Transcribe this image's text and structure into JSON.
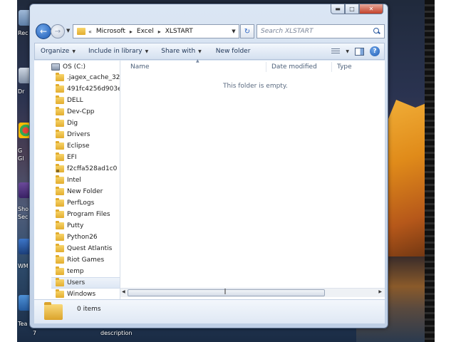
{
  "desktop": {
    "icon_labels": [
      "Rec",
      "Dr",
      "G",
      "Gl",
      "Sho",
      "Sec",
      "WM",
      "Tea"
    ],
    "below_window": {
      "left_text": "7",
      "description": "description"
    }
  },
  "window": {
    "address_crumbs": [
      "Microsoft",
      "Excel",
      "XLSTART"
    ],
    "search_placeholder": "Search XLSTART",
    "commands": {
      "organize": "Organize",
      "include_in_library": "Include in library",
      "share_with": "Share with",
      "new_folder": "New folder"
    },
    "tree": {
      "drive": "OS (C:)",
      "folders": [
        ".jagex_cache_32",
        "491fc4256d903e",
        "DELL",
        "Dev-Cpp",
        "Dig",
        "Drivers",
        "Eclipse",
        "EFI",
        "f2cffa528ad1c0",
        "Intel",
        "New Folder",
        "PerfLogs",
        "Program Files",
        "Putty",
        "Python26",
        "Quest Atlantis",
        "Riot Games",
        "temp",
        "Users",
        "Windows"
      ],
      "selected": "Users"
    },
    "columns": {
      "name": "Name",
      "date_modified": "Date modified",
      "type": "Type"
    },
    "empty_message": "This folder is empty.",
    "details": {
      "item_count": "0 items"
    }
  }
}
